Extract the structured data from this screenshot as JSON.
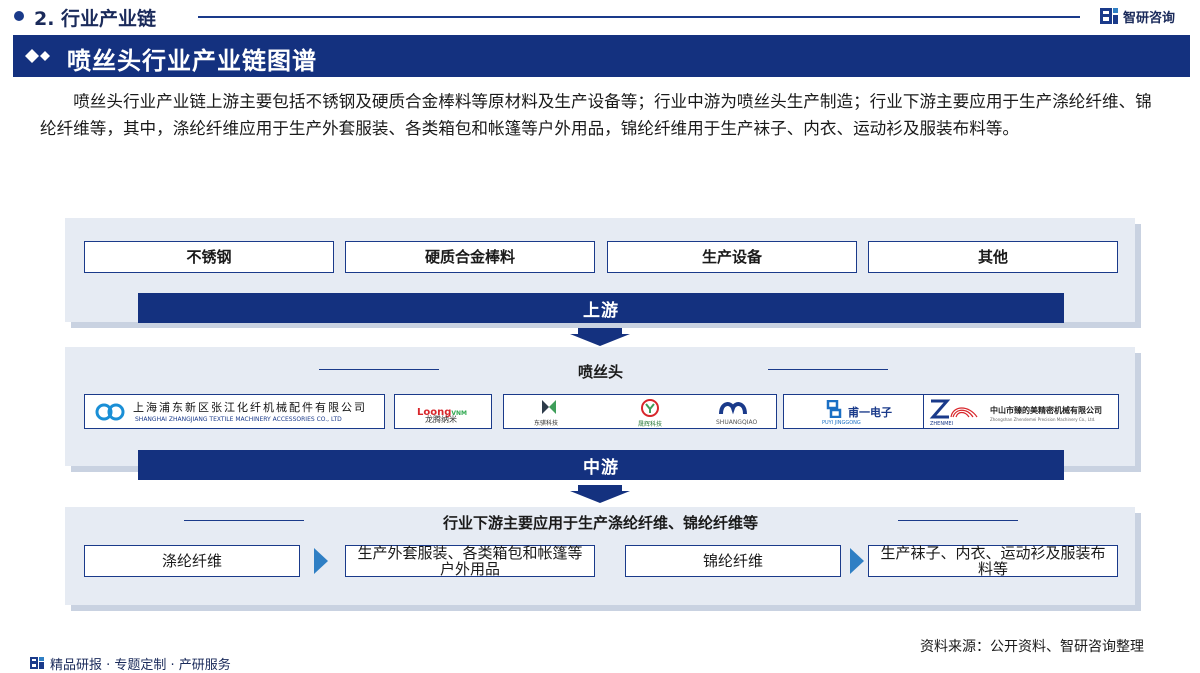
{
  "top_bar": {
    "section_title": "2. 行业产业链",
    "brand_name": "智研咨询"
  },
  "header": {
    "title": "喷丝头行业产业链图谱"
  },
  "intro": "喷丝头行业产业链上游主要包括不锈钢及硬质合金棒料等原材料及生产设备等；行业中游为喷丝头生产制造；行业下游主要应用于生产涤纶纤维、锦纶纤维等，其中，涤纶纤维应用于生产外套服装、各类箱包和帐篷等户外用品，锦纶纤维用于生产袜子、内衣、运动衫及服装布料等。",
  "upstream": {
    "items": [
      "不锈钢",
      "硬质合金棒料",
      "生产设备",
      "其他"
    ],
    "stage_label": "上游"
  },
  "midstream": {
    "section_label": "喷丝头",
    "stage_label": "中游",
    "companies": {
      "zhangjiang": {
        "name_cn": "上海浦东新区张江化纤机械配件有限公司",
        "name_en": "SHANGHAI ZHANGJIANG TEXTILE MACHINERY ACCESSORIES CO., LTD"
      },
      "loong": {
        "mark": "Loong",
        "mark2": "VNM",
        "name_cn": "龙腾纳米"
      },
      "dongqi": {
        "name_cn": "东骐科技"
      },
      "shenghui": {
        "name_cn": "晟辉科技"
      },
      "shuangqiao": {
        "name_en": "SHUANGQIAO"
      },
      "puyi": {
        "name_cn": "甫一电子",
        "mark": "PUYI JINGGONG"
      },
      "zhenmei": {
        "mark": "ZHENMEI",
        "name_cn": "中山市臻的美精密机械有限公司",
        "name_en": "Zhongshan Zhendemei Precision Machinery Co., Ltd."
      }
    }
  },
  "downstream": {
    "section_label": "行业下游主要应用于生产涤纶纤维、锦纶纤维等",
    "flow": [
      {
        "fiber": "涤纶纤维",
        "product": "生产外套服装、各类箱包和帐篷等户外用品"
      },
      {
        "fiber": "锦纶纤维",
        "product": "生产袜子、内衣、运动衫及服装布料等"
      }
    ]
  },
  "footer": {
    "source": "资料来源：公开资料、智研咨询整理",
    "tagline": "精品研报 · 专题定制 · 产研服务"
  },
  "colors": {
    "brand_navy": "#14317f",
    "panel_bg": "#e6ebf3",
    "arrow_blue": "#2f7fc4"
  }
}
